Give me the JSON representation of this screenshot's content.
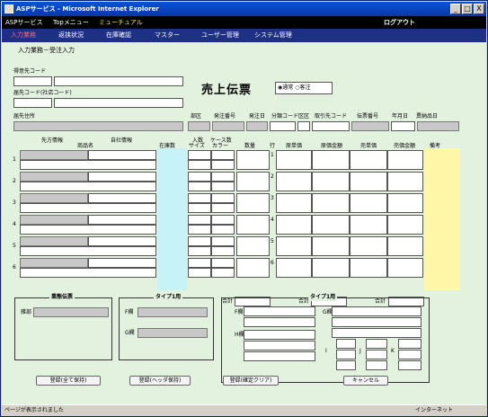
{
  "window": {
    "title": "ASPサービス - Microsoft Internet Explorer",
    "min": "_",
    "max": "□",
    "close": "X"
  },
  "menu": {
    "items": [
      "ASPサービス",
      "Topメニュー",
      "ミューチュアル"
    ],
    "logout": "ログアウト"
  },
  "subnav": [
    "入力業務",
    "返挟状況",
    "在庫確認",
    "マスター",
    "ユーザー管理",
    "システム管理"
  ],
  "page": {
    "breadcrumb": "入力業務－受注入力",
    "title": "売上伝票",
    "radio_normal": "通常",
    "radio_guest": "客注"
  },
  "labels": {
    "customer_code": "得意先コード",
    "delivery_code": "届先コード(社店コード)",
    "delivery_addr": "届先住所",
    "h_bunrui": "部区",
    "h_order_no": "発注番号",
    "h_order_date": "発注日",
    "h_cat": "分類コード",
    "h_ku": "区区",
    "h_trade": "取引先コード",
    "h_slip": "伝票番号",
    "h_ym": "年月日",
    "h_nyuka": "異納品日",
    "c_client": "先方情報",
    "c_product": "商品名",
    "c_self": "自社情報",
    "c_stock": "在庫数",
    "c_size_a": "入数",
    "c_size_b": "サイズ",
    "c_case_a": "ケース数",
    "c_case_b": "カラー",
    "c_qty": "数量",
    "c_row": "行",
    "c_cost": "原単価",
    "c_cost_amt": "原価金額",
    "c_price": "売単価",
    "c_sales_amt": "売価金額",
    "c_note": "備考",
    "total": "合計",
    "fs1": "業態伝票",
    "fs1_label": "雑部",
    "fs2": "タイプ1用",
    "fs2_f": "F欄",
    "fs2_g": "G欄",
    "fs3": "タイプ1用",
    "fs3_f": "F欄",
    "fs3_h": "H欄",
    "fs3_g": "G欄",
    "fs3_i": "I",
    "fs3_j": "J",
    "fs3_k": "K"
  },
  "rows": [
    "1",
    "2",
    "3",
    "4",
    "5",
    "6"
  ],
  "buttons": [
    "登録(全て保持)",
    "登録(ヘッダ保持)",
    "登録(確定クリア)",
    "キャンセル"
  ],
  "status": {
    "left": "ページが表示されました",
    "right": "インターネット"
  }
}
